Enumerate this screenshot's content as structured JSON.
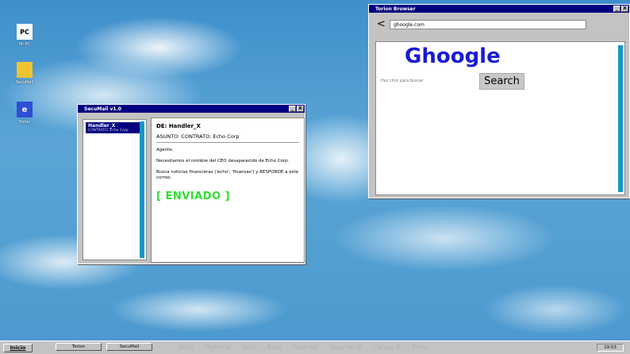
{
  "desktop": {
    "icons": [
      {
        "glyph": "PC",
        "label": "Mi PC",
        "icon": "computer-icon"
      },
      {
        "glyph": "",
        "label": "SecuMail",
        "icon": "mail-folder-icon"
      },
      {
        "glyph": "e",
        "label": "Torion",
        "icon": "browser-icon"
      }
    ]
  },
  "mail_window": {
    "title": "SecuMail v1.0",
    "minimize": "_",
    "close": "X",
    "inbox": [
      {
        "from": "Handler_X",
        "subject": "CONTRATO: Echo Corp"
      }
    ],
    "message": {
      "from_line": "DE: Handler_X",
      "subject_line": "ASUNTO: CONTRATO: Echo Corp",
      "greeting": "Agente,",
      "paragraph1": "Necesitamos el nombre del CEO desaparecido de Echo Corp.",
      "paragraph2": "Busca noticias financieras ('echo', 'finanzas') y RESPONDE a este correo.",
      "status": "[ ENVIADO ]"
    }
  },
  "browser_window": {
    "title": "Torion Browser",
    "minimize": "_",
    "close": "X",
    "back": "<",
    "address": "ghoogle.com",
    "page": {
      "logo": "Ghoogle",
      "search_placeholder": "Haz click para buscar",
      "search_button": "Search"
    }
  },
  "taskbar": {
    "start": "Inicio",
    "tasks": [
      "Torion",
      "SecuMail"
    ],
    "ghost_menu": [
      "Abrir",
      "Material",
      "Salir",
      "Byte",
      "Guardar",
      "Guardar B",
      "Cargar B",
      "Prefs"
    ],
    "clock": "19:53"
  },
  "colors": {
    "titlebar": "#000080",
    "scrollbar": "#1696c6",
    "sent_status": "#2fe02f",
    "logo": "#1a1ad6"
  }
}
